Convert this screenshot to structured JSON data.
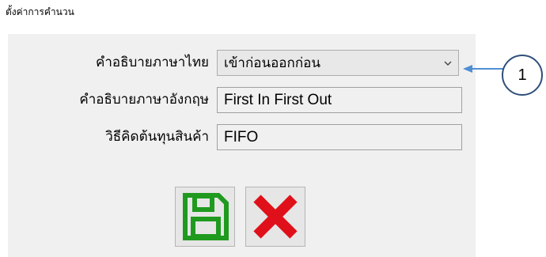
{
  "window": {
    "title": "ตั้งค่าการคำนวน"
  },
  "form": {
    "thai_description": {
      "label": "คำอธิบายภาษาไทย",
      "value": "เข้าก่อนออกก่อน"
    },
    "english_description": {
      "label": "คำอธิบายภาษาอังกฤษ",
      "value": "First In First Out"
    },
    "cost_method": {
      "label": "วิธีคิดต้นทุนสินค้า",
      "value": "FIFO"
    }
  },
  "buttons": {
    "save_icon": "floppy-disk-icon",
    "cancel_icon": "red-x-icon"
  },
  "annotation": {
    "number": "1"
  },
  "colors": {
    "save": "#1f9a1f",
    "cancel": "#e0101a",
    "arrow": "#4f8fd4",
    "circle": "#2f4f7a"
  }
}
